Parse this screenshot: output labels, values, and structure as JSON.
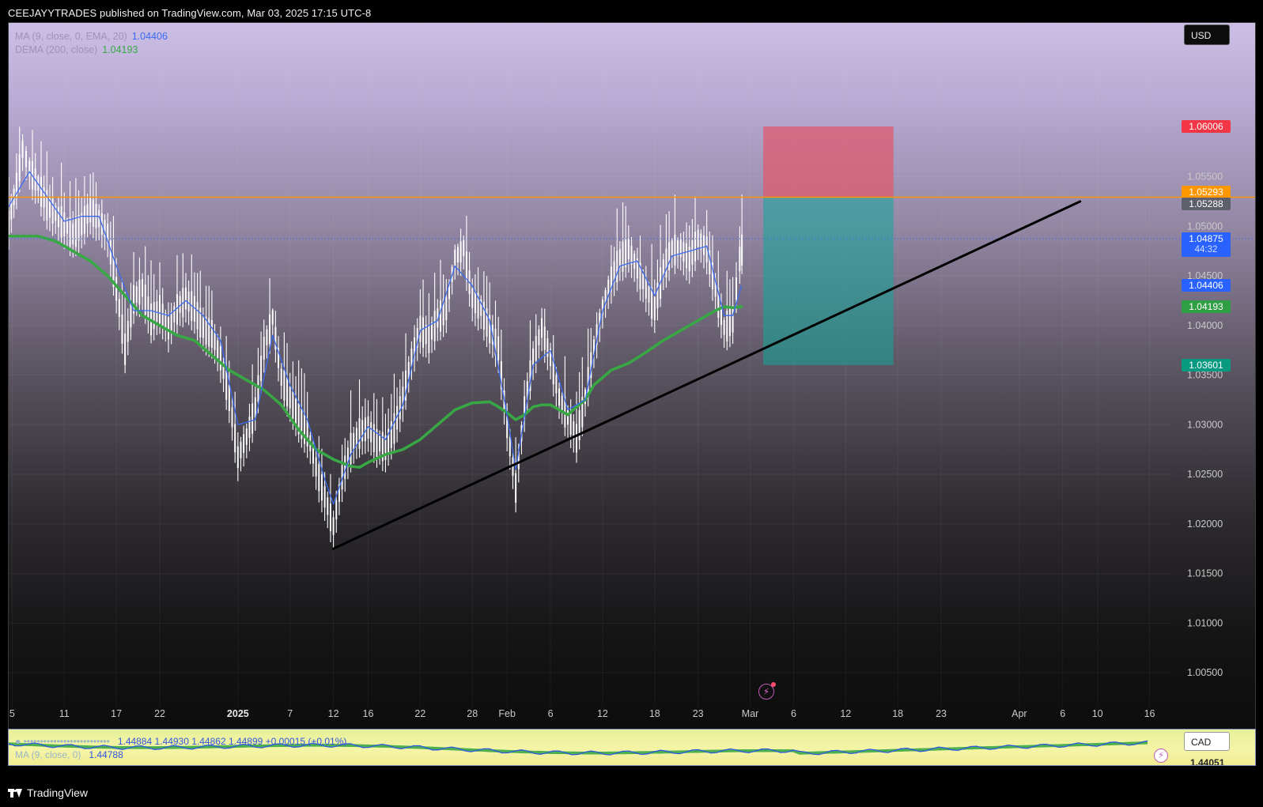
{
  "header": {
    "publisher_line": "CEEJAYYTRADES published on TradingView.com, Mar 03, 2025 17:15 UTC-8"
  },
  "legend": {
    "ema": {
      "label": "MA (9, close, 0, EMA, 20)",
      "value": "1.04406",
      "color": "#3b6cf0"
    },
    "dema": {
      "label": "DEMA (200, close)",
      "value": "1.04193",
      "color": "#37a844"
    }
  },
  "currency_button": "USD",
  "price_labels": [
    {
      "name": "stop-loss",
      "text": "1.06006",
      "price": 1.06006,
      "bg": "#f23645"
    },
    {
      "name": "resistance",
      "text": "1.05293",
      "price": 1.05293,
      "bg": "#ff9800"
    },
    {
      "name": "entry",
      "text": "1.05288",
      "price": 1.05288,
      "bg": "#5d606b"
    },
    {
      "name": "last-price",
      "text": "1.04875",
      "sub": "44:32",
      "price": 1.04875,
      "bg": "#2962ff"
    },
    {
      "name": "ema",
      "text": "1.04406",
      "price": 1.04406,
      "bg": "#2962ff"
    },
    {
      "name": "dema",
      "text": "1.04193",
      "price": 1.04193,
      "bg": "#2f9e44"
    },
    {
      "name": "take-profit",
      "text": "1.03601",
      "price": 1.03601,
      "bg": "#089981"
    }
  ],
  "subchart": {
    "legend_line1": "1.44884   1.44930   1.44862   1.44899   +0.00015 (+0.01%)",
    "legend_line2_label": "MA (9, close, 0)",
    "legend_line2_value": "1.44788",
    "currency_button": "CAD",
    "price": "1.44051"
  },
  "footer": {
    "brand": "TradingView"
  },
  "chart_data": {
    "type": "line",
    "yaxis_ticks": [
      1.055,
      1.05,
      1.045,
      1.04,
      1.035,
      1.03,
      1.025,
      1.02,
      1.015,
      1.01,
      1.005
    ],
    "ylim": [
      1.0015,
      1.0705
    ],
    "xaxis_ticks": [
      {
        "label": "5",
        "day": -3,
        "bold": false
      },
      {
        "label": "11",
        "day": 3,
        "bold": false
      },
      {
        "label": "17",
        "day": 9,
        "bold": false
      },
      {
        "label": "22",
        "day": 14,
        "bold": false
      },
      {
        "label": "2025",
        "day": 23,
        "bold": true
      },
      {
        "label": "7",
        "day": 29,
        "bold": false
      },
      {
        "label": "12",
        "day": 34,
        "bold": false
      },
      {
        "label": "16",
        "day": 38,
        "bold": false
      },
      {
        "label": "22",
        "day": 44,
        "bold": false
      },
      {
        "label": "28",
        "day": 50,
        "bold": false
      },
      {
        "label": "Feb",
        "day": 54,
        "bold": false
      },
      {
        "label": "6",
        "day": 59,
        "bold": false
      },
      {
        "label": "12",
        "day": 65,
        "bold": false
      },
      {
        "label": "18",
        "day": 71,
        "bold": false
      },
      {
        "label": "23",
        "day": 76,
        "bold": false
      },
      {
        "label": "Mar",
        "day": 82,
        "bold": false
      },
      {
        "label": "6",
        "day": 87,
        "bold": false
      },
      {
        "label": "12",
        "day": 93,
        "bold": false
      },
      {
        "label": "18",
        "day": 99,
        "bold": false
      },
      {
        "label": "23",
        "day": 104,
        "bold": false
      },
      {
        "label": "Apr",
        "day": 113,
        "bold": false
      },
      {
        "label": "6",
        "day": 118,
        "bold": false
      },
      {
        "label": "10",
        "day": 122,
        "bold": false
      },
      {
        "label": "16",
        "day": 128,
        "bold": false
      }
    ],
    "xlim_days": [
      -3.4,
      130.5
    ],
    "price_path": [
      [
        -3.4,
        1.0505
      ],
      [
        -2.5,
        1.0545
      ],
      [
        -1.8,
        1.058
      ],
      [
        -1,
        1.056
      ],
      [
        0,
        1.0545
      ],
      [
        1,
        1.0525
      ],
      [
        2,
        1.0515
      ],
      [
        3,
        1.0505
      ],
      [
        4,
        1.0495
      ],
      [
        5,
        1.0505
      ],
      [
        6,
        1.052
      ],
      [
        7,
        1.051
      ],
      [
        8,
        1.0495
      ],
      [
        9,
        1.044
      ],
      [
        10,
        1.038
      ],
      [
        11,
        1.043
      ],
      [
        12,
        1.044
      ],
      [
        13,
        1.041
      ],
      [
        14,
        1.042
      ],
      [
        15,
        1.04
      ],
      [
        16,
        1.042
      ],
      [
        17,
        1.043
      ],
      [
        18,
        1.042
      ],
      [
        19,
        1.04
      ],
      [
        20,
        1.0395
      ],
      [
        21,
        1.037
      ],
      [
        22,
        1.033
      ],
      [
        23,
        1.027
      ],
      [
        24,
        1.029
      ],
      [
        25,
        1.032
      ],
      [
        26,
        1.038
      ],
      [
        27,
        1.041
      ],
      [
        28,
        1.035
      ],
      [
        29,
        1.033
      ],
      [
        30,
        1.031
      ],
      [
        31,
        1.0295
      ],
      [
        32,
        1.026
      ],
      [
        33,
        1.023
      ],
      [
        34,
        1.02
      ],
      [
        35,
        1.025
      ],
      [
        36,
        1.028
      ],
      [
        37,
        1.0295
      ],
      [
        38,
        1.03
      ],
      [
        39,
        1.0285
      ],
      [
        40,
        1.028
      ],
      [
        41,
        1.03
      ],
      [
        42,
        1.033
      ],
      [
        43,
        1.037
      ],
      [
        44,
        1.04
      ],
      [
        45,
        1.039
      ],
      [
        46,
        1.041
      ],
      [
        47,
        1.042
      ],
      [
        48,
        1.047
      ],
      [
        49,
        1.048
      ],
      [
        50,
        1.043
      ],
      [
        51,
        1.042
      ],
      [
        52,
        1.04
      ],
      [
        53,
        1.038
      ],
      [
        54,
        1.03
      ],
      [
        55,
        1.024
      ],
      [
        56,
        1.032
      ],
      [
        57,
        1.037
      ],
      [
        58,
        1.04
      ],
      [
        59,
        1.037
      ],
      [
        60,
        1.033
      ],
      [
        61,
        1.031
      ],
      [
        62,
        1.029
      ],
      [
        63,
        1.033
      ],
      [
        64,
        1.038
      ],
      [
        65,
        1.042
      ],
      [
        66,
        1.045
      ],
      [
        67,
        1.047
      ],
      [
        68,
        1.048
      ],
      [
        69,
        1.046
      ],
      [
        70,
        1.044
      ],
      [
        71,
        1.042
      ],
      [
        72,
        1.046
      ],
      [
        73,
        1.048
      ],
      [
        74,
        1.048
      ],
      [
        75,
        1.047
      ],
      [
        76,
        1.049
      ],
      [
        77,
        1.048
      ],
      [
        78,
        1.044
      ],
      [
        79,
        1.04
      ],
      [
        80,
        1.041
      ],
      [
        80.8,
        1.047
      ],
      [
        81.3,
        1.049
      ]
    ],
    "dema_path": [
      [
        -3.4,
        1.049
      ],
      [
        0,
        1.049
      ],
      [
        2,
        1.0485
      ],
      [
        4,
        1.0475
      ],
      [
        6,
        1.0465
      ],
      [
        8,
        1.045
      ],
      [
        10,
        1.043
      ],
      [
        12,
        1.041
      ],
      [
        14,
        1.04
      ],
      [
        16,
        1.039
      ],
      [
        18,
        1.0385
      ],
      [
        20,
        1.037
      ],
      [
        22,
        1.0355
      ],
      [
        24,
        1.0345
      ],
      [
        26,
        1.0335
      ],
      [
        28,
        1.032
      ],
      [
        30,
        1.0295
      ],
      [
        32,
        1.0275
      ],
      [
        34,
        1.0265
      ],
      [
        36,
        1.0258
      ],
      [
        37,
        1.0257
      ],
      [
        38,
        1.0262
      ],
      [
        40,
        1.027
      ],
      [
        42,
        1.0275
      ],
      [
        44,
        1.0285
      ],
      [
        46,
        1.03
      ],
      [
        48,
        1.0315
      ],
      [
        50,
        1.0322
      ],
      [
        52,
        1.0323
      ],
      [
        53,
        1.0318
      ],
      [
        54,
        1.0312
      ],
      [
        55,
        1.0305
      ],
      [
        56,
        1.031
      ],
      [
        57,
        1.0318
      ],
      [
        58,
        1.032
      ],
      [
        59,
        1.032
      ],
      [
        60,
        1.0315
      ],
      [
        61,
        1.031
      ],
      [
        62,
        1.0318
      ],
      [
        63,
        1.0325
      ],
      [
        64,
        1.034
      ],
      [
        66,
        1.0355
      ],
      [
        68,
        1.0362
      ],
      [
        70,
        1.0373
      ],
      [
        72,
        1.0385
      ],
      [
        74,
        1.0395
      ],
      [
        76,
        1.0405
      ],
      [
        78,
        1.0415
      ],
      [
        79,
        1.0419
      ],
      [
        80,
        1.0418
      ],
      [
        81,
        1.0419
      ]
    ],
    "ema_path": [
      [
        -3.4,
        1.052
      ],
      [
        -1,
        1.0555
      ],
      [
        1,
        1.053
      ],
      [
        3,
        1.0505
      ],
      [
        5,
        1.051
      ],
      [
        7,
        1.051
      ],
      [
        9,
        1.046
      ],
      [
        11,
        1.0415
      ],
      [
        13,
        1.0415
      ],
      [
        15,
        1.041
      ],
      [
        17,
        1.0425
      ],
      [
        19,
        1.041
      ],
      [
        21,
        1.0385
      ],
      [
        23,
        1.03
      ],
      [
        25,
        1.0305
      ],
      [
        27,
        1.039
      ],
      [
        29,
        1.034
      ],
      [
        31,
        1.0305
      ],
      [
        33,
        1.0245
      ],
      [
        34,
        1.022
      ],
      [
        36,
        1.027
      ],
      [
        38,
        1.0298
      ],
      [
        40,
        1.0285
      ],
      [
        42,
        1.032
      ],
      [
        44,
        1.0395
      ],
      [
        46,
        1.0405
      ],
      [
        48,
        1.046
      ],
      [
        50,
        1.044
      ],
      [
        52,
        1.0405
      ],
      [
        54,
        1.031
      ],
      [
        55,
        1.0255
      ],
      [
        57,
        1.036
      ],
      [
        59,
        1.0375
      ],
      [
        61,
        1.0315
      ],
      [
        63,
        1.0325
      ],
      [
        65,
        1.0415
      ],
      [
        67,
        1.046
      ],
      [
        69,
        1.0465
      ],
      [
        71,
        1.043
      ],
      [
        73,
        1.047
      ],
      [
        75,
        1.0475
      ],
      [
        77,
        1.048
      ],
      [
        79,
        1.041
      ],
      [
        80,
        1.041
      ],
      [
        81,
        1.044
      ]
    ],
    "resistance_price": 1.05293,
    "current_price": 1.04875,
    "trendline": {
      "start": [
        34,
        1.0175
      ],
      "end": [
        120,
        1.0525
      ]
    },
    "position_box": {
      "day_start": 83.5,
      "day_end": 98.5,
      "stop": 1.06006,
      "entry": 1.05288,
      "target": 1.03601
    },
    "colors": {
      "candle": "#ffffff",
      "ema": "#3b6cf0",
      "dema": "#37a844",
      "resistance": "#ff9800",
      "trendline": "#000000",
      "risk": "#e0596e",
      "reward": "#13a89a",
      "axis_text": "#c9c9c9"
    }
  }
}
